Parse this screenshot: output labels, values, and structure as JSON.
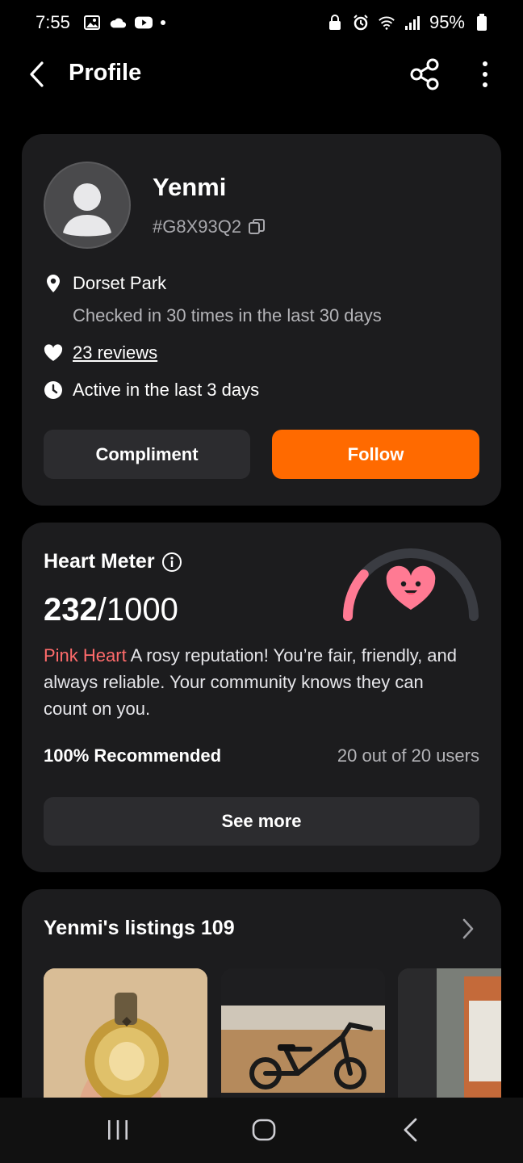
{
  "status_bar": {
    "time": "7:55",
    "battery": "95%",
    "icons_left": [
      "gallery-icon",
      "cloud-icon",
      "youtube-icon",
      "notification-dot"
    ],
    "icons_right": [
      "lock-icon",
      "alarm-icon",
      "wifi-icon",
      "signal-icon",
      "battery-icon"
    ]
  },
  "header": {
    "title": "Profile"
  },
  "profile": {
    "name": "Yenmi",
    "user_id": "#G8X93Q2",
    "location": "Dorset Park",
    "checkin": "Checked in 30 times in the last 30 days",
    "reviews": "23 reviews",
    "active": "Active in the last 3 days",
    "compliment_label": "Compliment",
    "follow_label": "Follow"
  },
  "heart_meter": {
    "title": "Heart Meter",
    "score": "232",
    "max": "/1000",
    "score_fraction": 0.232,
    "tier": "Pink Heart",
    "description": " A rosy reputation! You’re fair, friendly, and always reliable. Your community knows they can count on you.",
    "recommended_label": "100% Recommended",
    "recommended_count": "20 out of 20 users",
    "see_more_label": "See more"
  },
  "listings": {
    "title": "Yenmi's listings 109"
  },
  "colors": {
    "accent": "#ff6a00",
    "card": "#1c1c1e",
    "pink": "#ff7a93",
    "tier_text": "#ff6b6b"
  }
}
